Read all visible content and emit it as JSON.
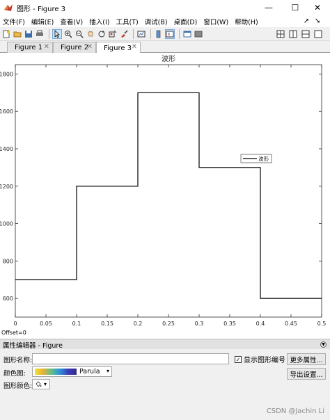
{
  "window": {
    "title": "图形 - Figure 3"
  },
  "menu": {
    "items": [
      "文件(F)",
      "编辑(E)",
      "查看(V)",
      "插入(I)",
      "工具(T)",
      "调试(B)",
      "桌面(D)",
      "窗口(W)",
      "帮助(H)"
    ]
  },
  "tabs": [
    {
      "label": "Figure 1",
      "active": false
    },
    {
      "label": "Figure 2",
      "active": false
    },
    {
      "label": "Figure 3",
      "active": true
    }
  ],
  "chart_data": {
    "type": "line",
    "style": "stairs",
    "title": "波形",
    "xlim": [
      0,
      0.5
    ],
    "ylim": [
      500,
      1850
    ],
    "xticks": [
      0,
      0.05,
      0.1,
      0.15,
      0.2,
      0.25,
      0.3,
      0.35,
      0.4,
      0.45,
      0.5
    ],
    "xtick_labels": [
      "0",
      "0.05",
      "0.1",
      "0.15",
      "0.2",
      "0.25",
      "0.3",
      "0.35",
      "0.4",
      "0.45",
      "0.5"
    ],
    "yticks": [
      600,
      800,
      1000,
      1200,
      1400,
      1600,
      1800
    ],
    "ytick_labels": [
      "600",
      "800",
      "1000",
      "1200",
      "1400",
      "1600",
      "1800"
    ],
    "series": [
      {
        "name": "波形",
        "color": "#000000",
        "x": [
          0,
          0.1,
          0.2,
          0.3,
          0.4,
          0.5
        ],
        "values": [
          700,
          1200,
          1700,
          1300,
          600,
          600
        ]
      }
    ],
    "legend_position": "right",
    "grid": false
  },
  "status": {
    "offset": "Offset=0"
  },
  "property_editor": {
    "header": "属性编辑器 - Figure",
    "name_label": "图形名称:",
    "name_value": "",
    "show_number_label": "显示图形编号",
    "show_number_checked": true,
    "more_props_button": "更多属性...",
    "colormap_label": "颜色图:",
    "colormap_value": "Parula",
    "export_button": "导出设置...",
    "figure_color_label": "图形颜色:"
  },
  "watermark": "CSDN @Jachin Li"
}
